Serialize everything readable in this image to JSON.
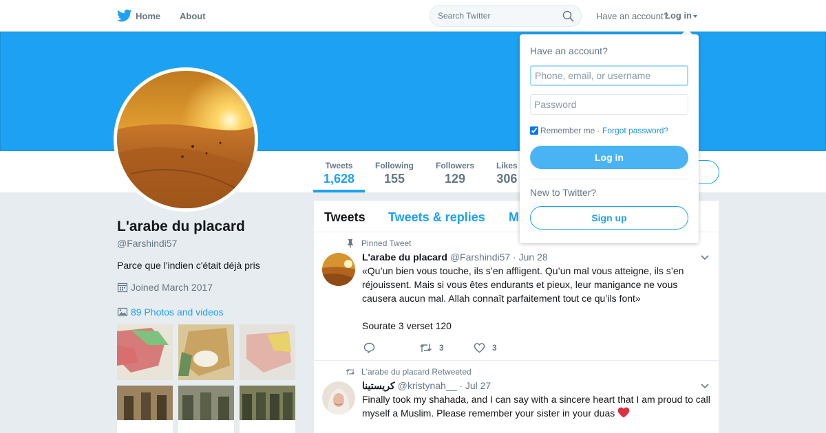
{
  "nav": {
    "home": "Home",
    "about": "About",
    "search_placeholder": "Search Twitter",
    "have_account": "Have an account?",
    "login": "Log in"
  },
  "profile": {
    "name": "L'arabe du placard",
    "handle": "@Farshindi57",
    "bio": "Parce que l'indien c'était déjà pris",
    "joined": "Joined March 2017",
    "photos_link": "89 Photos and videos"
  },
  "stats": [
    {
      "label": "Tweets",
      "value": "1,628",
      "active": true
    },
    {
      "label": "Following",
      "value": "155",
      "active": false
    },
    {
      "label": "Followers",
      "value": "129",
      "active": false
    },
    {
      "label": "Likes",
      "value": "306",
      "active": false
    }
  ],
  "timeline_tabs": [
    "Tweets",
    "Tweets & replies",
    "M"
  ],
  "tweets": [
    {
      "context": "Pinned Tweet",
      "name": "L'arabe du placard",
      "handle": "@Farshindi57",
      "date": "· Jun 28",
      "text": "«Qu’un bien vous touche, ils s’en affligent. Qu’un mal vous atteigne, ils s’en réjouissent. Mais si vous êtes endurants et pieux, leur manigance ne vous causera aucun mal. Allah connaît parfaitement tout ce qu’ils font»",
      "text2": "Sourate 3 verset 120",
      "retweets": "3",
      "likes": "3"
    },
    {
      "context": "L'arabe du placard Retweeted",
      "name": "كريستينا",
      "handle": "@kristynah__",
      "date": "· Jul 27",
      "text": "Finally took my shahada, and I can say with a sincere heart that I am proud to call myself a Muslim. Please remember your sister in your duas"
    }
  ],
  "login_dropdown": {
    "title": "Have an account?",
    "username_placeholder": "Phone, email, or username",
    "password_placeholder": "Password",
    "remember_me": "Remember me",
    "separator": " · ",
    "forgot_password": "Forgot password?",
    "login_button": "Log in",
    "new_to_twitter": "New to Twitter?",
    "signup_button": "Sign up"
  },
  "colors": {
    "brand_blue": "#1da1f2",
    "banner": "#1da1f2",
    "background": "#e6ecf0"
  }
}
